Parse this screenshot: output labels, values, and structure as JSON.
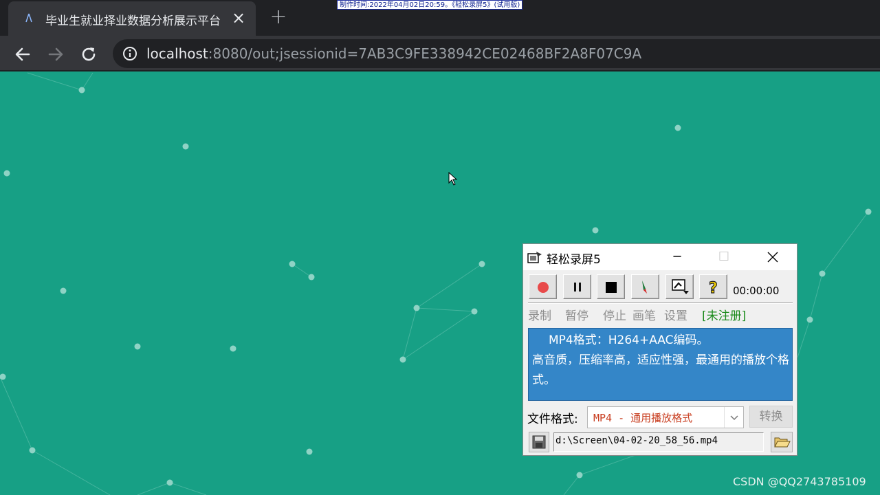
{
  "browser": {
    "tab_title": "毕业生就业择业数据分析展示平台",
    "url_host": "localhost",
    "url_rest": ":8080/out;jsessionid=7AB3C9FE338942CE02468BF2A8F07C9A"
  },
  "overlay": {
    "recording_banner": "制作时间:2022年04月02日20:59。《轻松录屏5》(试用版)",
    "watermark": "CSDN @QQ2743785109"
  },
  "recorder": {
    "title": "轻松录屏5",
    "timer": "00:00:00",
    "button_labels": {
      "record": "录制",
      "pause": "暂停",
      "stop": "停止",
      "pen": "画笔",
      "settings": "设置"
    },
    "registration": "[未注册]",
    "description_line1": "MP4格式：H264+AAC编码。",
    "description_line2": "高音质，压缩率高，适应性强，最通用的播放个格式。",
    "format_label": "文件格式:",
    "format_value": "MP4 - 通用播放格式",
    "convert_label": "转换",
    "output_path": "d:\\Screen\\04-02-20_58_56.mp4"
  },
  "colors": {
    "page_background": "#17a085",
    "description_background": "#3486c8",
    "record_red": "#e84a4a",
    "format_text": "#c83c1e",
    "registration_green": "#1a8a1a"
  }
}
